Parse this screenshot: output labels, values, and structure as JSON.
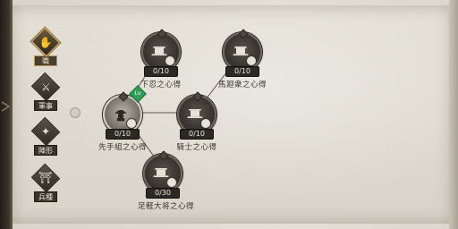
{
  "sidebar": {
    "tabs": [
      {
        "label": "職",
        "glyph": "✋",
        "icon": "hand-icon",
        "active": true
      },
      {
        "label": "軍事",
        "glyph": "⚔",
        "icon": "helmet-icon",
        "active": false
      },
      {
        "label": "陣形",
        "glyph": "✦",
        "icon": "formation-icon",
        "active": false
      },
      {
        "label": "兵種",
        "glyph": "⛩",
        "icon": "gate-icon",
        "active": false
      }
    ]
  },
  "tree": {
    "nodes": [
      {
        "id": "kanin",
        "label": "下忍之心得",
        "progress": "0/10",
        "icon": "palanquin-icon"
      },
      {
        "id": "bahou",
        "label": "馬廻衆之心得",
        "progress": "0/10",
        "icon": "palanquin-icon"
      },
      {
        "id": "sakite",
        "label": "先手組之心得",
        "progress": "0/10",
        "icon": "samurai-icon",
        "badge": "Lv",
        "highlight": true
      },
      {
        "id": "kishi",
        "label": "騎士之心得",
        "progress": "0/10",
        "icon": "palanquin-icon"
      },
      {
        "id": "ashigaru",
        "label": "足軽大将之心得",
        "progress": "0/30",
        "icon": "palanquin-icon"
      }
    ]
  },
  "colors": {
    "paper": "#e1ddd4",
    "node_dark": "#3b3732",
    "node_light": "#b9b5ad",
    "badge_green": "#2f9e56",
    "tab_accent": "#c9a760"
  }
}
